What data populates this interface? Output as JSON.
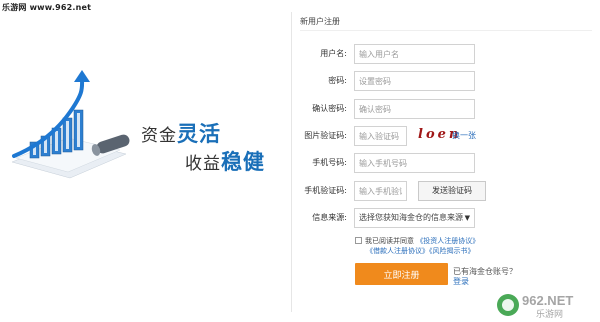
{
  "site_tag": "乐游网 www.962.net",
  "promo": {
    "slogan1_plain": "资金",
    "slogan1_highlight": "灵活",
    "slogan2_plain": "收益",
    "slogan2_highlight": "稳健"
  },
  "form": {
    "title": "新用户注册",
    "username": {
      "label": "用户名:",
      "placeholder": "输入用户名"
    },
    "password": {
      "label": "密码:",
      "placeholder": "设置密码"
    },
    "confirm": {
      "label": "确认密码:",
      "placeholder": "确认密码"
    },
    "captcha": {
      "label": "图片验证码:",
      "placeholder": "输入验证码",
      "image_text": "loen",
      "refresh": "换一张"
    },
    "phone": {
      "label": "手机号码:",
      "placeholder": "输入手机号码"
    },
    "sms": {
      "label": "手机验证码:",
      "placeholder": "输入手机验证",
      "button": "发送验证码"
    },
    "source": {
      "label": "信息来源:",
      "selected": "选择您获知海金仓的信息来源"
    },
    "agree": {
      "prefix": "我已阅读并同意",
      "link1": "《投资人注册协议》",
      "link2": "《借款人注册协议》",
      "link3": "《风险揭示书》"
    },
    "submit": "立即注册",
    "have_account": "已有海金仓账号？",
    "login": "登录"
  },
  "watermark": {
    "main": "962.NET",
    "sub": "乐游网"
  },
  "colors": {
    "accent_blue": "#1a6fb8",
    "submit_orange": "#f08a1c",
    "link_blue": "#2a6ebb"
  }
}
